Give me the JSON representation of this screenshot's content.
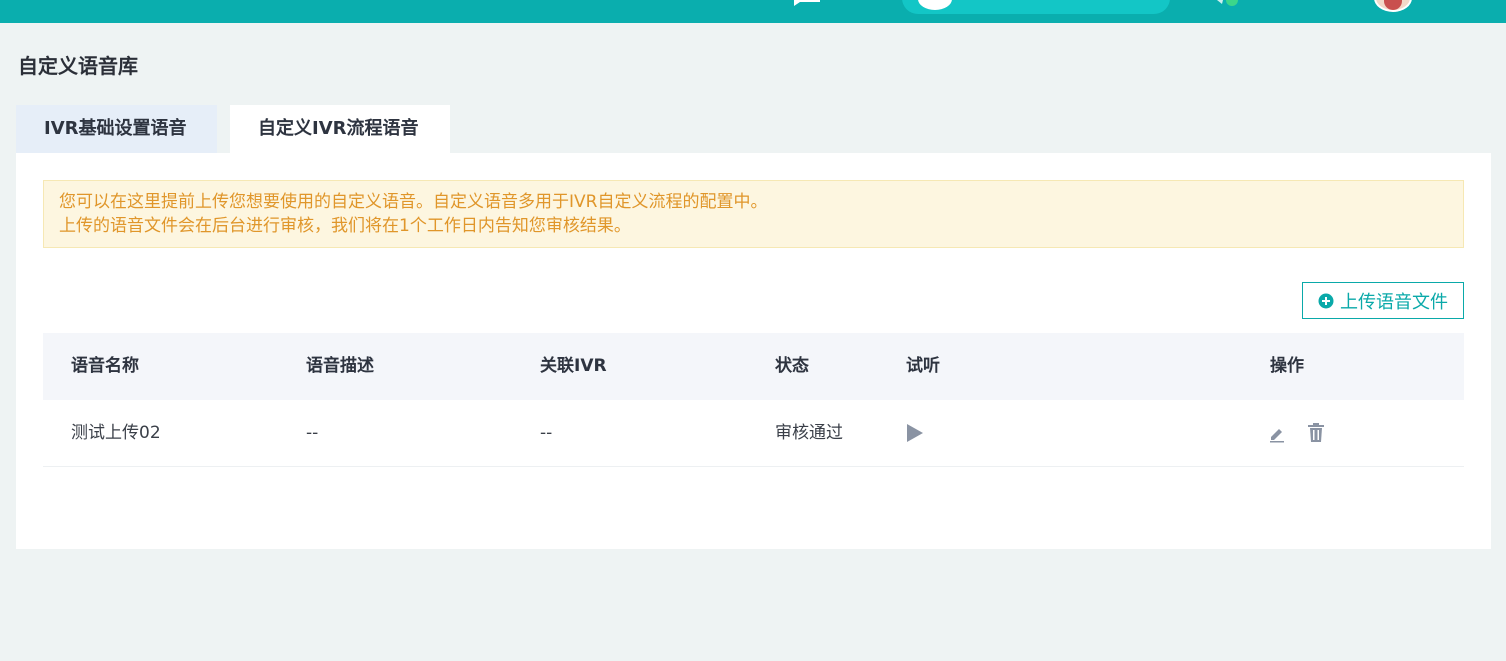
{
  "page": {
    "title": "自定义语音库"
  },
  "tabs": [
    {
      "label": "IVR基础设置语音",
      "active": false
    },
    {
      "label": "自定义IVR流程语音",
      "active": true
    }
  ],
  "notice": {
    "line1": "您可以在这里提前上传您想要使用的自定义语音。自定义语音多用于IVR自定义流程的配置中。",
    "line2": "上传的语音文件会在后台进行审核，我们将在1个工作日内告知您审核结果。"
  },
  "toolbar": {
    "upload_label": "上传语音文件"
  },
  "table": {
    "headers": [
      "语音名称",
      "语音描述",
      "关联IVR",
      "状态",
      "试听",
      "操作"
    ],
    "rows": [
      {
        "name": "测试上传02",
        "description": "--",
        "ivr": "--",
        "status": "审核通过"
      }
    ]
  },
  "colors": {
    "brand": "#0aaeae",
    "notice_text": "#e0962a",
    "notice_bg": "#fdf6e0",
    "icon_gray": "#8a93a3"
  },
  "icons": [
    "chat-icon",
    "search-icon",
    "notification-icon",
    "avatar",
    "plus-circle-icon",
    "play-icon",
    "edit-icon",
    "delete-icon"
  ]
}
